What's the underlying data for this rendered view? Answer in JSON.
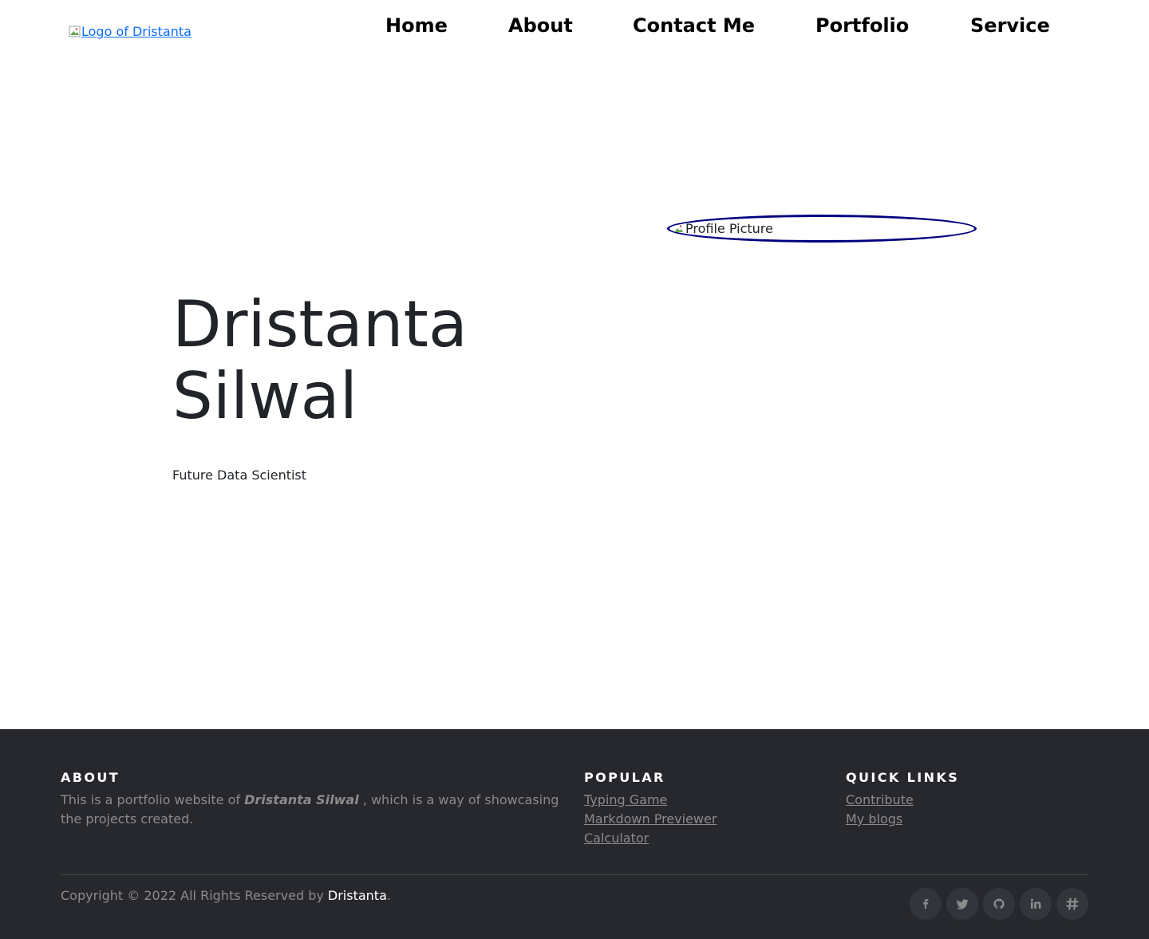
{
  "header": {
    "logo_alt": "Logo of Dristanta",
    "nav": [
      {
        "label": "Home"
      },
      {
        "label": "About"
      },
      {
        "label": "Contact Me"
      },
      {
        "label": "Portfolio"
      },
      {
        "label": "Service"
      }
    ]
  },
  "hero": {
    "profile_alt": "Profile Picture",
    "name_line1": "Dristanta",
    "name_line2": "Silwal",
    "tagline": "Future Data Scientist"
  },
  "footer": {
    "about": {
      "title": "About",
      "text_before": "This is a portfolio website of ",
      "name": "Dristanta Silwal",
      "text_after": " , which is a way of showcasing the projects created."
    },
    "popular": {
      "title": "Popular",
      "links": [
        "Typing Game",
        "Markdown Previewer",
        "Calculator"
      ]
    },
    "quick_links": {
      "title": "Quick Links",
      "links": [
        "Contribute",
        "My blogs"
      ]
    },
    "copyright": {
      "text": "Copyright © 2022 All Rights Reserved by ",
      "author": "Dristanta",
      "suffix": "."
    },
    "socials": [
      {
        "icon": "facebook-icon",
        "glyph": "f"
      },
      {
        "icon": "twitter-icon",
        "glyph": "🐦"
      },
      {
        "icon": "github-icon",
        "glyph": "⌥"
      },
      {
        "icon": "linkedin-icon",
        "glyph": "in"
      },
      {
        "icon": "hashnode-icon",
        "glyph": "#"
      }
    ]
  },
  "colors": {
    "link": "#0d6efd",
    "profile_border": "#000080",
    "footer_bg": "#27282d",
    "footer_text": "#8b8b8b"
  }
}
